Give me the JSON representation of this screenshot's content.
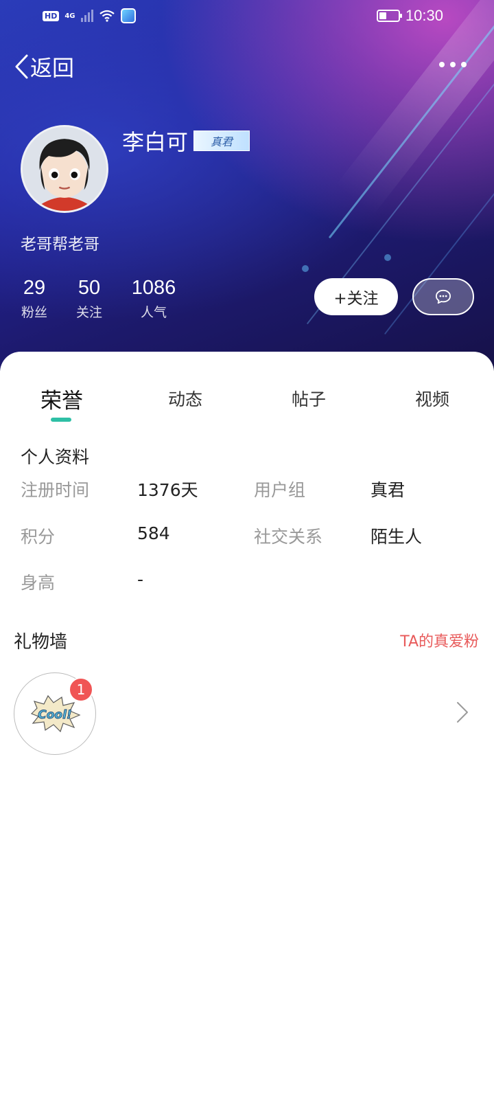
{
  "status_bar": {
    "hd": "HD",
    "network": "4G",
    "time": "10:30",
    "battery_level": 0.4
  },
  "nav": {
    "back_label": "返回",
    "back_icon": "chevron-left-icon",
    "more_icon": "more-dots-icon"
  },
  "profile": {
    "name": "李白可",
    "rank_badge": "真君",
    "signature": "老哥帮老哥",
    "stats": [
      {
        "value": "29",
        "label": "粉丝"
      },
      {
        "value": "50",
        "label": "关注"
      },
      {
        "value": "1086",
        "label": "人气"
      }
    ],
    "follow_label": "+关注",
    "message_icon": "chat-bubble-icon"
  },
  "tabs": [
    {
      "label": "荣誉",
      "active": true
    },
    {
      "label": "动态",
      "active": false
    },
    {
      "label": "帖子",
      "active": false
    },
    {
      "label": "视频",
      "active": false
    }
  ],
  "personal_info": {
    "title": "个人资料",
    "rows": [
      {
        "label": "注册时间",
        "value": "1376天"
      },
      {
        "label": "用户组",
        "value": "真君"
      },
      {
        "label": "积分",
        "value": "584"
      },
      {
        "label": "社交关系",
        "value": "陌生人"
      },
      {
        "label": "身高",
        "value": "-"
      }
    ]
  },
  "gift_wall": {
    "title": "礼物墙",
    "link": "TA的真爱粉",
    "gift_text": "Cool!",
    "gift_count": "1",
    "chevron_icon": "chevron-right-icon"
  },
  "colors": {
    "accent": "#2ebfa5",
    "link_red": "#e85a5a",
    "badge_red": "#f05555",
    "header_dark": "#1d1a6e"
  }
}
